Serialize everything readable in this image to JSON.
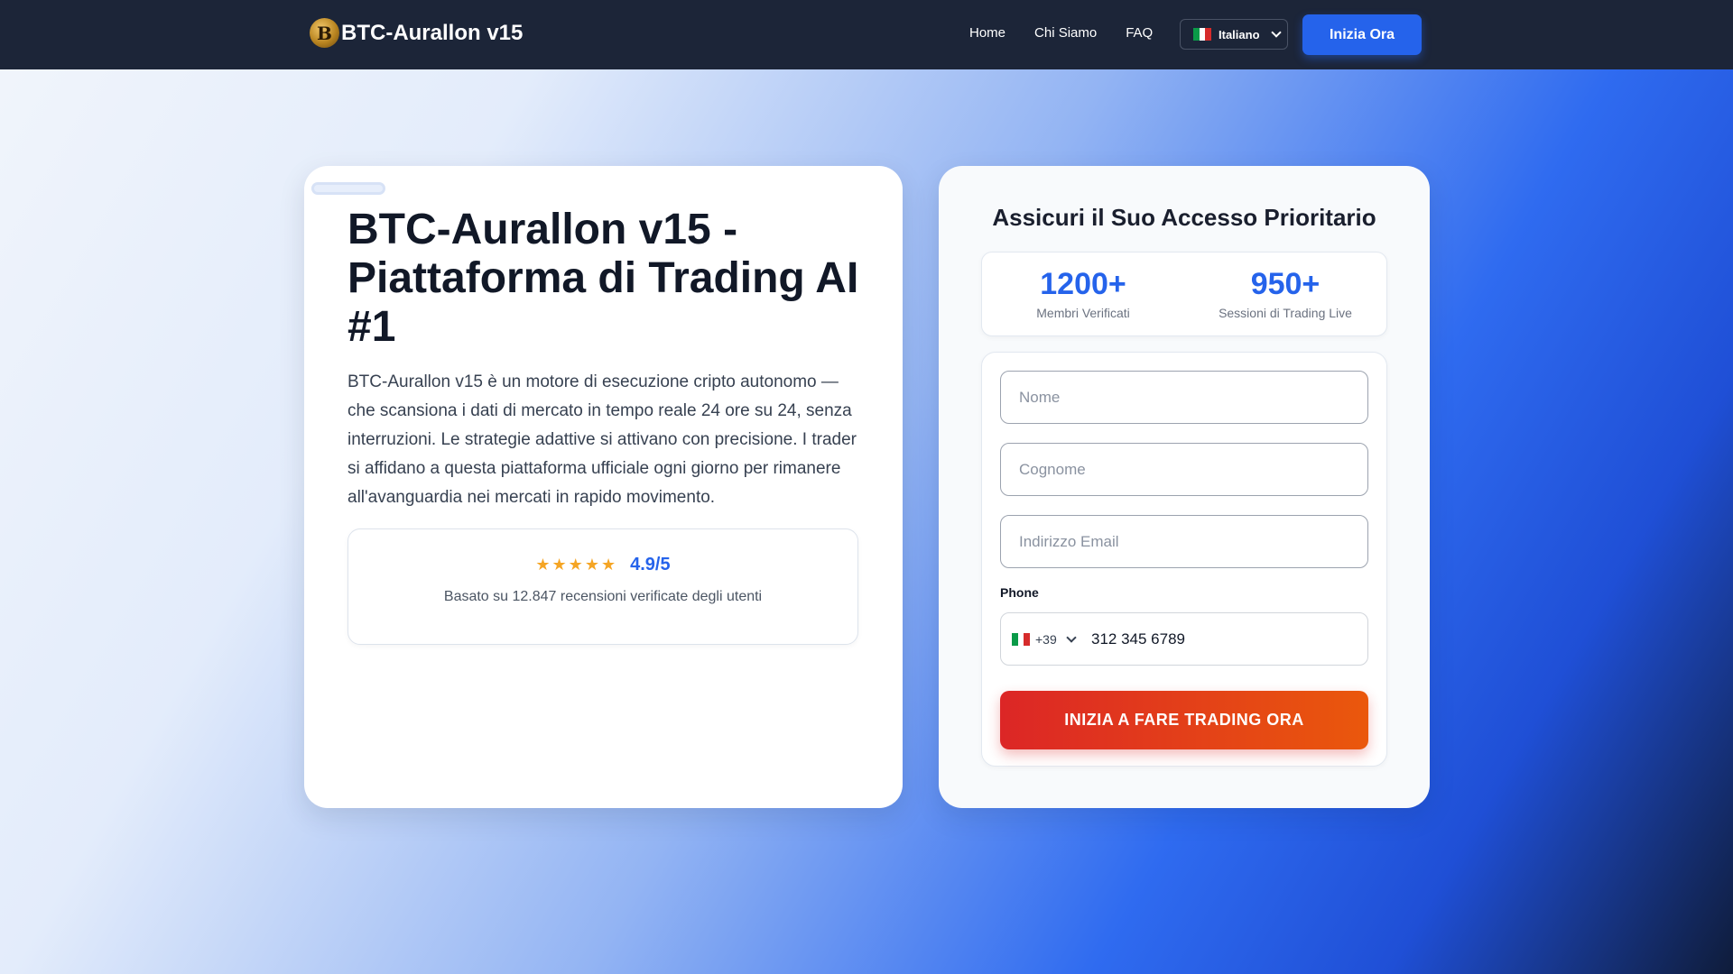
{
  "navbar": {
    "brand_logo_glyph": "B",
    "brand_name": "BTC-Aurallon v15",
    "links": [
      "Home",
      "Chi Siamo",
      "FAQ"
    ],
    "language": "Italiano",
    "cta_label": "Inizia Ora"
  },
  "hero": {
    "title": "BTC-Aurallon v15 - Piattaforma di Trading AI #1",
    "description": "BTC-Aurallon v15 è un motore di esecuzione cripto autonomo — che scansiona i dati di mercato in tempo reale 24 ore su 24, senza interruzioni. Le strategie adattive si attivano con precisione. I trader si affidano a questa piattaforma ufficiale ogni giorno per rimanere all'avanguardia nei mercati in rapido movimento.",
    "rating": {
      "stars": "★★★★★",
      "score": "4.9/5",
      "subtitle": "Basato su 12.847 recensioni verificate degli utenti"
    }
  },
  "form": {
    "title": "Assicuri il Suo Accesso Prioritario",
    "stats": [
      {
        "value": "1200+",
        "label": "Membri Verificati"
      },
      {
        "value": "950+",
        "label": "Sessioni di Trading Live"
      }
    ],
    "first_name_placeholder": "Nome",
    "last_name_placeholder": "Cognome",
    "email_placeholder": "Indirizzo Email",
    "phone_label": "Phone",
    "phone_country_code": "+39",
    "phone_value": "312 345 6789",
    "submit_label": "INIZIA A FARE TRADING ORA"
  },
  "colors": {
    "navbar_bg": "#1c2538",
    "accent": "#2563eb",
    "cta_gradient_start": "#dc2626",
    "cta_gradient_end": "#ea580c",
    "star": "#f5a524"
  }
}
